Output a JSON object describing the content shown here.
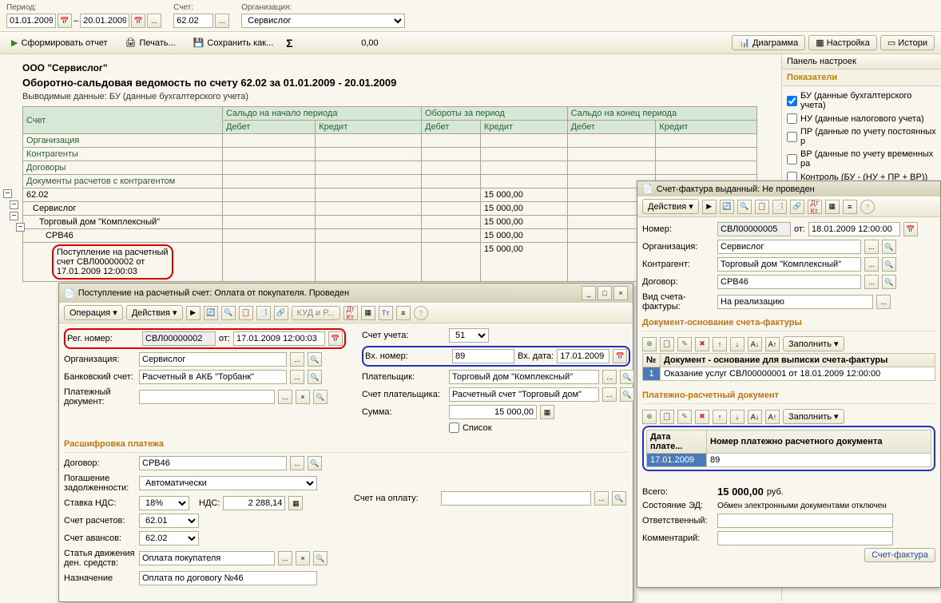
{
  "filters": {
    "period_label": "Период:",
    "date_from": "01.01.2009",
    "date_to": "20.01.2009",
    "account_label": "Счет:",
    "account": "62.02",
    "org_label": "Организация:",
    "org": "Сервислог"
  },
  "toolbar": {
    "generate": "Сформировать отчет",
    "print": "Печать...",
    "save": "Сохранить как...",
    "sigma_val": "0,00",
    "diagram": "Диаграмма",
    "settings": "Настройка",
    "history": "Истори"
  },
  "report": {
    "org": "ООО \"Сервислог\"",
    "title": "Оборотно-сальдовая ведомость по счету 62.02 за 01.01.2009 - 20.01.2009",
    "info": "Выводимые данные: БУ (данные бухгалтерского учета)",
    "cols": {
      "acct": "Счет",
      "start": "Сальдо на начало периода",
      "turn": "Обороты за период",
      "end": "Сальдо на конец периода",
      "org": "Организация",
      "contr": "Контрагенты",
      "dog": "Договоры",
      "docs": "Документы расчетов с контрагентом",
      "debit": "Дебет",
      "credit": "Кредит"
    },
    "rows": {
      "r1": "62.02",
      "r2": "Сервислог",
      "r3": "Торговый дом \"Комплексный\"",
      "r4": "СРВ46",
      "r5a": "Поступление на расчетный",
      "r5b": "счет СВЛ00000002 от",
      "r5c": "17.01.2009 12:00:03",
      "v": "15 000,00"
    }
  },
  "settings": {
    "panel_title": "Панель настроек",
    "section": "Показатели",
    "items": [
      {
        "label": "БУ (данные бухгалтерского учета)",
        "checked": true
      },
      {
        "label": "НУ (данные налогового учета)",
        "checked": false
      },
      {
        "label": "ПР (данные по учету постоянных р",
        "checked": false
      },
      {
        "label": "ВР (данные по учету временных ра",
        "checked": false
      },
      {
        "label": "Контроль (БУ - (НУ + ПР + ВР))",
        "checked": false
      }
    ]
  },
  "dialog1": {
    "title": "Поступление на расчетный счет: Оплата от покупателя. Проведен",
    "operation": "Операция",
    "actions": "Действия",
    "kudir": "КУД и Р...",
    "reg_label": "Рег. номер:",
    "reg_no": "СВЛ00000002",
    "from_label": "от:",
    "reg_date": "17.01.2009 12:00:03",
    "org_label": "Организация:",
    "org": "Сервислог",
    "bank_label": "Банковский счет:",
    "bank": "Расчетный в АКБ \"Торбанк\"",
    "paydoc_label": "Платежный документ:",
    "paydoc": "",
    "scheta_label": "Счет учета:",
    "scheta": "51",
    "vh_no_label": "Вх. номер:",
    "vh_no": "89",
    "vh_data_label": "Вх. дата:",
    "vh_data": "17.01.2009",
    "payer_label": "Плательщик:",
    "payer": "Торговый дом \"Комплексный\"",
    "payer_acct_label": "Счет плательщика:",
    "payer_acct": "Расчетный счет \"Торговый дом\"",
    "sum_label": "Сумма:",
    "sum": "15 000,00",
    "list": "Список",
    "section": "Расшифровка платежа",
    "dogovor_label": "Договор:",
    "dogovor": "СРВ46",
    "repay_label": "Погашение задолженности:",
    "repay": "Автоматически",
    "vat_label": "Ставка НДС:",
    "vat": "18%",
    "nds_label": "НДС:",
    "nds": "2 288,14",
    "oplat_label": "Счет на оплату:",
    "calc_acct_label": "Счет расчетов:",
    "calc_acct": "62.01",
    "adv_acct_label": "Счет авансов:",
    "adv_acct": "62.02",
    "move_label": "Статья движения ден. средств:",
    "move": "Оплата покупателя",
    "purpose_label": "Назначение",
    "purpose": "Оплата по договory №46"
  },
  "dialog2": {
    "title": "Счет-фактура выданный: Не проведен",
    "actions": "Действия",
    "number_label": "Номер:",
    "number": "СВЛ00000005",
    "from_label": "от:",
    "date": "18.01.2009 12:00:00",
    "org_label": "Организация:",
    "org": "Сервислог",
    "contr_label": "Контрагент:",
    "contr": "Торговый дом \"Комплексный\"",
    "dog_label": "Договор:",
    "dog": "СРВ46",
    "type_label": "Вид счета-фактуры:",
    "type": "На реализацию",
    "section1": "Документ-основание счета-фактуры",
    "fill": "Заполнить",
    "col_n": "№",
    "col_doc": "Документ - основание для выписки счета-фактуры",
    "row1_n": "1",
    "row1_doc": "Оказание услуг СВЛ00000001 от 18.01.2009 12:00:00",
    "section2": "Платежно-расчетный документ",
    "col_date": "Дата плате...",
    "col_num": "Номер платежно расчетного документа",
    "row2_date": "17.01.2009",
    "row2_num": "89",
    "total_label": "Всего:",
    "total": "15 000,00",
    "rub": "руб.",
    "ed_label": "Состояние ЭД:",
    "ed": "Обмен электронными документами отключен",
    "resp_label": "Ответственный:",
    "comm_label": "Комментарий:",
    "sf_btn": "Счет-фактура"
  }
}
